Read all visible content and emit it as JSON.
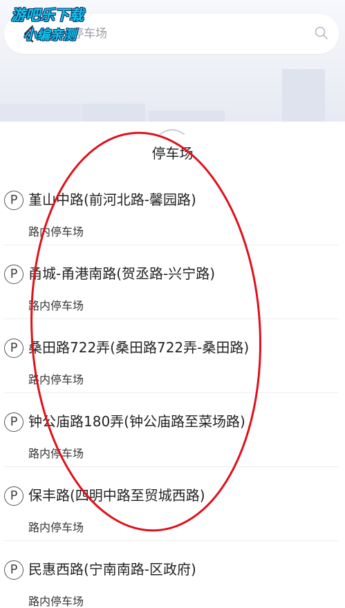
{
  "watermark": {
    "line1": "游吧乐下载",
    "line2": "小编亲测"
  },
  "search": {
    "text": "停车场"
  },
  "panel": {
    "title": "停车场"
  },
  "parking_list": [
    {
      "name": "堇山中路(前河北路-馨园路)",
      "type": "路内停车场"
    },
    {
      "name": "甬城-甬港南路(贺丞路-兴宁路)",
      "type": "路内停车场"
    },
    {
      "name": "桑田路722弄(桑田路722弄-桑田路)",
      "type": "路内停车场"
    },
    {
      "name": "钟公庙路180弄(钟公庙路至菜场路)",
      "type": "路内停车场"
    },
    {
      "name": "保丰路(四明中路至贸城西路)",
      "type": "路内停车场"
    },
    {
      "name": "民惠西路(宁南南路-区政府)",
      "type": "路内停车场"
    }
  ],
  "parking_icon_glyph": "P",
  "colors": {
    "annotation": "#e0101a",
    "watermark": "#12c4e8"
  }
}
